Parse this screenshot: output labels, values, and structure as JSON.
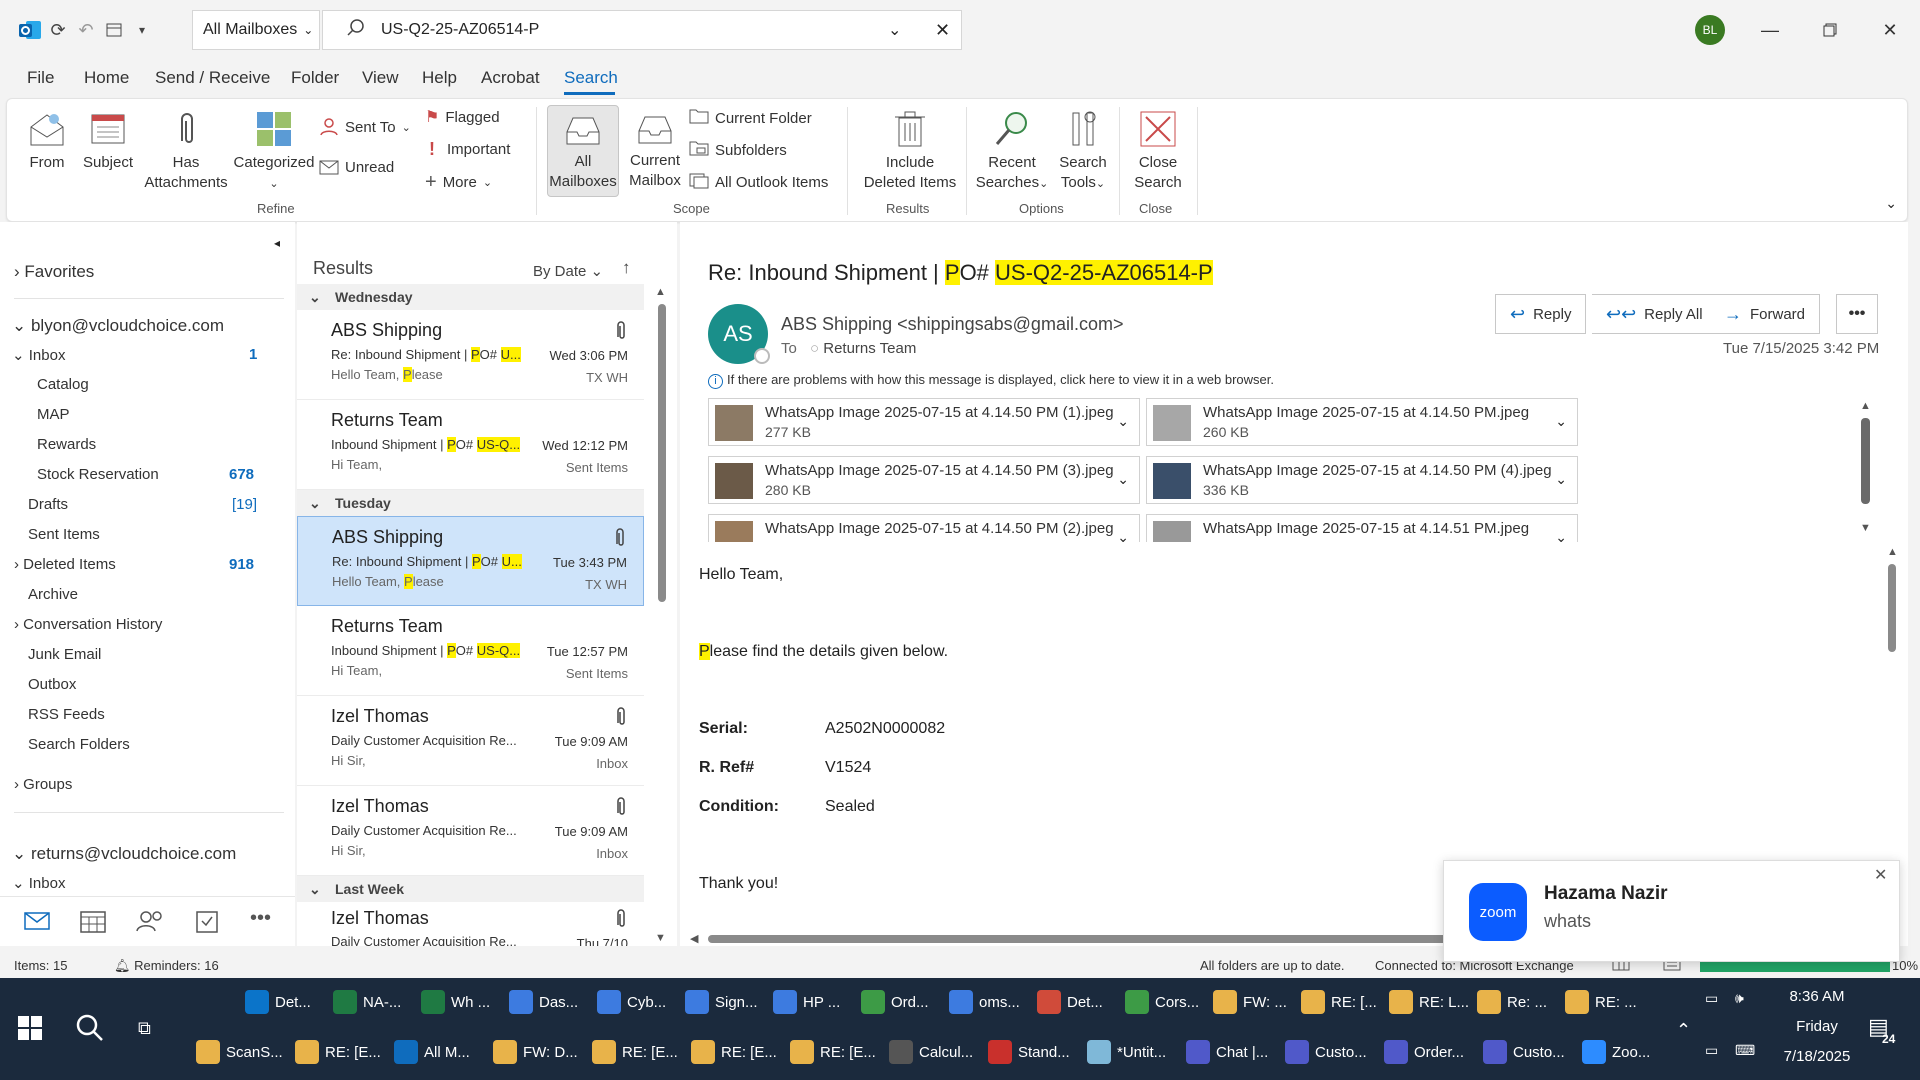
{
  "titlebar": {
    "mailbox_scope": "All Mailboxes",
    "search_query": "US-Q2-25-AZ06514-P",
    "user_initials": "BL"
  },
  "menu": [
    "File",
    "Home",
    "Send / Receive",
    "Folder",
    "View",
    "Help",
    "Acrobat",
    "Search"
  ],
  "ribbon": {
    "refine": {
      "from": "From",
      "subject": "Subject",
      "has": "Has",
      "attachments": "Attachments",
      "categorized": "Categorized",
      "sent_to": "Sent To",
      "unread": "Unread",
      "flagged": "Flagged",
      "important": "Important",
      "more": "More",
      "label": "Refine"
    },
    "scope": {
      "all": "All",
      "mailboxes": "Mailboxes",
      "current": "Current",
      "mailbox": "Mailbox",
      "current_folder": "Current Folder",
      "subfolders": "Subfolders",
      "all_outlook": "All Outlook Items",
      "label": "Scope"
    },
    "results": {
      "include": "Include",
      "deleted": "Deleted Items",
      "label": "Results"
    },
    "options": {
      "recent": "Recent",
      "searches": "Searches",
      "search": "Search",
      "tools": "Tools",
      "label": "Options"
    },
    "close": {
      "close": "Close",
      "search": "Search",
      "label": "Close"
    }
  },
  "nav": {
    "favorites": "Favorites",
    "account1": "blyon@vcloudchoice.com",
    "inbox": "Inbox",
    "inbox_count": "1",
    "catalog": "Catalog",
    "map": "MAP",
    "rewards": "Rewards",
    "stock": "Stock Reservation",
    "stock_count": "678",
    "drafts": "Drafts",
    "drafts_count": "[19]",
    "sent": "Sent Items",
    "deleted": "Deleted Items",
    "deleted_count": "918",
    "archive": "Archive",
    "conv": "Conversation History",
    "junk": "Junk Email",
    "outbox": "Outbox",
    "rss": "RSS Feeds",
    "search_folders": "Search Folders",
    "groups": "Groups",
    "account2": "returns@vcloudchoice.com",
    "inbox2": "Inbox"
  },
  "results": {
    "title": "Results",
    "sort": "By Date",
    "groups": [
      "Wednesday",
      "Tuesday",
      "Last Week"
    ],
    "rows": [
      {
        "from": "ABS Shipping",
        "subj_pre": "Re: Inbound Shipment | ",
        "subj_p": "P",
        "subj_o": "O# ",
        "subj_hl": "U...",
        "prev_pre": "Hello Team,  ",
        "prev_hl": "P",
        "prev_post": "lease",
        "date": "Wed 3:06 PM",
        "folder": "TX WH"
      },
      {
        "from": "Returns Team",
        "subj_pre": "Inbound Shipment | ",
        "subj_p": "P",
        "subj_o": "O# ",
        "subj_hl": "US-Q...",
        "prev_pre": "Hi Team,",
        "prev_hl": "",
        "prev_post": "",
        "date": "Wed 12:12 PM",
        "folder": "Sent Items"
      },
      {
        "from": "ABS Shipping",
        "subj_pre": "Re: Inbound Shipment | ",
        "subj_p": "P",
        "subj_o": "O# ",
        "subj_hl": "U...",
        "prev_pre": "Hello Team,  ",
        "prev_hl": "P",
        "prev_post": "lease",
        "date": "Tue 3:43 PM",
        "folder": "TX WH"
      },
      {
        "from": "Returns Team",
        "subj_pre": "Inbound Shipment | ",
        "subj_p": "P",
        "subj_o": "O# ",
        "subj_hl": "US-Q...",
        "prev_pre": "Hi Team,",
        "prev_hl": "",
        "prev_post": "",
        "date": "Tue 12:57 PM",
        "folder": "Sent Items"
      },
      {
        "from": "Izel Thomas",
        "subj_pre": "Daily Customer Acquisition Re...",
        "subj_p": "",
        "subj_o": "",
        "subj_hl": "",
        "prev_pre": "Hi Sir,",
        "prev_hl": "",
        "prev_post": "",
        "date": "Tue 9:09 AM",
        "folder": "Inbox"
      },
      {
        "from": "Izel Thomas",
        "subj_pre": "Daily Customer Acquisition Re...",
        "subj_p": "",
        "subj_o": "",
        "subj_hl": "",
        "prev_pre": "Hi Sir,",
        "prev_hl": "",
        "prev_post": "",
        "date": "Tue 9:09 AM",
        "folder": "Inbox"
      },
      {
        "from": "Izel Thomas",
        "subj_pre": "Daily Customer Acquisition Re...",
        "subj_p": "",
        "subj_o": "",
        "subj_hl": "",
        "prev_pre": "",
        "prev_hl": "",
        "prev_post": "",
        "date": "Thu 7/10",
        "folder": ""
      }
    ]
  },
  "message": {
    "subject_pre": "Re: Inbound Shipment | ",
    "subject_p": "P",
    "subject_o": "O# ",
    "subject_hl": "US-Q2-25-AZ06514-P",
    "avatar": "AS",
    "sender": "ABS Shipping <shippingsabs@gmail.com>",
    "to_label": "To",
    "to": "Returns Team",
    "datetime": "Tue 7/15/2025 3:42 PM",
    "info": "If there are problems with how this message is displayed, click here to view it in a web browser.",
    "reply": "Reply",
    "reply_all": "Reply All",
    "forward": "Forward",
    "attachments": [
      {
        "name": "WhatsApp Image 2025-07-15 at 4.14.50 PM (1).jpeg",
        "size": "277 KB"
      },
      {
        "name": "WhatsApp Image 2025-07-15 at 4.14.50 PM.jpeg",
        "size": "260 KB"
      },
      {
        "name": "WhatsApp Image 2025-07-15 at 4.14.50 PM (3).jpeg",
        "size": "280 KB"
      },
      {
        "name": "WhatsApp Image 2025-07-15 at 4.14.50 PM (4).jpeg",
        "size": "336 KB"
      },
      {
        "name": "WhatsApp Image 2025-07-15 at 4.14.50 PM (2).jpeg",
        "size": ""
      },
      {
        "name": "WhatsApp Image 2025-07-15 at 4.14.51 PM.jpeg",
        "size": ""
      }
    ],
    "greeting": "Hello Team,",
    "line_p": "P",
    "line_rest": "lease find the details given below.",
    "serial_label": "Serial:",
    "serial": "A2502N0000082",
    "ref_label": "R. Ref#",
    "ref": "V1524",
    "cond_label": "Condition:",
    "cond": "Sealed",
    "thanks": "Thank you!"
  },
  "toast": {
    "brand": "zoom",
    "name": "Hazama Nazir",
    "text": "whats"
  },
  "status": {
    "items": "Items: 15",
    "reminders": "Reminders: 16",
    "uptodate": "All folders are up to date.",
    "connected": "Connected to: Microsoft Exchange",
    "zoom": "10%"
  },
  "taskbar": {
    "row1": [
      {
        "label": "Det...",
        "color": "#0b74c9"
      },
      {
        "label": "NA-...",
        "color": "#1f7a43"
      },
      {
        "label": "Wh ...",
        "color": "#1f7a43"
      },
      {
        "label": "Das...",
        "color": "#3d7be0"
      },
      {
        "label": "Cyb...",
        "color": "#3d7be0"
      },
      {
        "label": "Sign...",
        "color": "#3d7be0"
      },
      {
        "label": "HP ...",
        "color": "#3d7be0"
      },
      {
        "label": "Ord...",
        "color": "#3d9b46"
      },
      {
        "label": "oms...",
        "color": "#3d7be0"
      },
      {
        "label": "Det...",
        "color": "#d04b3a"
      },
      {
        "label": "Cors...",
        "color": "#3d9b46"
      },
      {
        "label": "FW: ...",
        "color": "#e8b34a"
      },
      {
        "label": "RE: [...",
        "color": "#e8b34a"
      },
      {
        "label": "RE: L...",
        "color": "#e8b34a"
      },
      {
        "label": "Re: ...",
        "color": "#e8b34a"
      },
      {
        "label": "RE: ...",
        "color": "#e8b34a"
      }
    ],
    "row2": [
      {
        "label": "ScanS...",
        "color": "#e8b34a"
      },
      {
        "label": "RE: [E...",
        "color": "#e8b34a"
      },
      {
        "label": "All M...",
        "color": "#0f6cbd"
      },
      {
        "label": "FW: D...",
        "color": "#e8b34a"
      },
      {
        "label": "RE: [E...",
        "color": "#e8b34a"
      },
      {
        "label": "RE: [E...",
        "color": "#e8b34a"
      },
      {
        "label": "RE: [E...",
        "color": "#e8b34a"
      },
      {
        "label": "Calcul...",
        "color": "#555"
      },
      {
        "label": "Stand...",
        "color": "#c9302c"
      },
      {
        "label": "*Untit...",
        "color": "#7fb8d8"
      },
      {
        "label": "Chat |...",
        "color": "#5059c9"
      },
      {
        "label": "Custo...",
        "color": "#5059c9"
      },
      {
        "label": "Order...",
        "color": "#5059c9"
      },
      {
        "label": "Custo...",
        "color": "#5059c9"
      },
      {
        "label": "Zoo...",
        "color": "#2d8cff"
      }
    ],
    "time": "8:36 AM",
    "day": "Friday",
    "date": "7/18/2025",
    "notif": "24"
  },
  "colors": {
    "accent": "#0f6cbd",
    "highlight": "#fff100",
    "taskbar": "#1b2a3d",
    "teams_badge": "#c4314b"
  }
}
